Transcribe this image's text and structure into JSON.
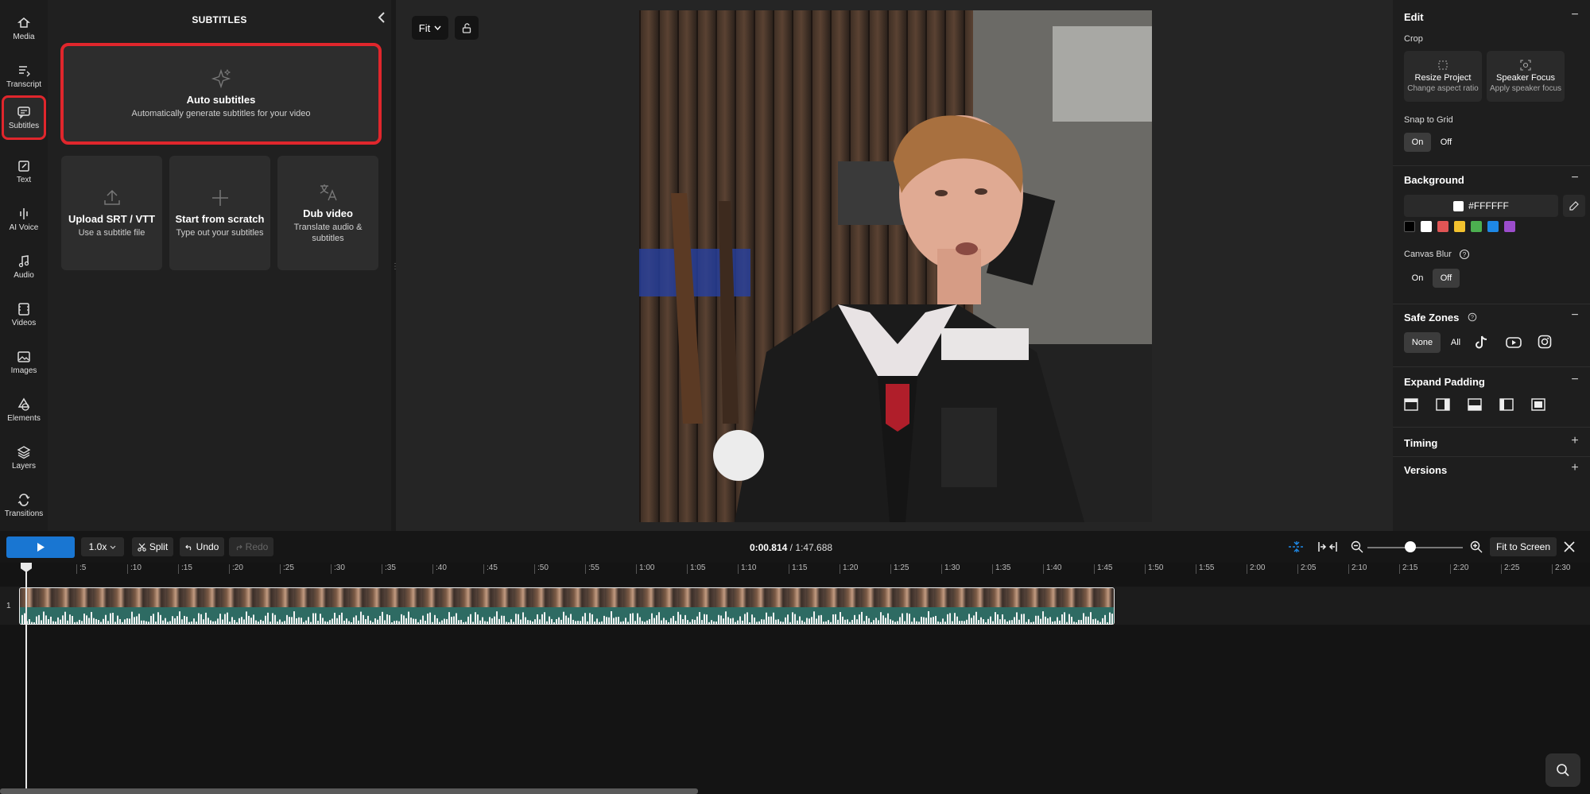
{
  "nav": {
    "items": [
      {
        "label": "Media",
        "icon": "media-icon"
      },
      {
        "label": "Transcript",
        "icon": "transcript-icon"
      },
      {
        "label": "Subtitles",
        "icon": "subtitles-icon"
      },
      {
        "label": "Text",
        "icon": "text-icon"
      },
      {
        "label": "AI Voice",
        "icon": "ai-voice-icon"
      },
      {
        "label": "Audio",
        "icon": "audio-icon"
      },
      {
        "label": "Videos",
        "icon": "videos-icon"
      },
      {
        "label": "Images",
        "icon": "images-icon"
      },
      {
        "label": "Elements",
        "icon": "elements-icon"
      },
      {
        "label": "Layers",
        "icon": "layers-icon"
      },
      {
        "label": "Transitions",
        "icon": "transitions-icon"
      }
    ],
    "active": "Subtitles"
  },
  "panel": {
    "title": "SUBTITLES",
    "auto": {
      "title": "Auto subtitles",
      "sub": "Automatically generate subtitles for your video"
    },
    "upload": {
      "title": "Upload SRT / VTT",
      "sub": "Use a subtitle file"
    },
    "scratch": {
      "title": "Start from scratch",
      "sub": "Type out your subtitles"
    },
    "dub": {
      "title": "Dub video",
      "sub": "Translate audio & subtitles"
    }
  },
  "canvas": {
    "fit_label": "Fit"
  },
  "right": {
    "edit": "Edit",
    "crop": "Crop",
    "resize": {
      "title": "Resize Project",
      "sub": "Change aspect ratio"
    },
    "speaker": {
      "title": "Speaker Focus",
      "sub": "Apply speaker focus"
    },
    "snap": "Snap to Grid",
    "on": "On",
    "off": "Off",
    "background": "Background",
    "bg_hex": "#FFFFFF",
    "swatches": [
      "#000000",
      "#ffffff",
      "#e05555",
      "#f2c12e",
      "#4caf50",
      "#1e88e5",
      "#9c4dcc"
    ],
    "canvas_blur": "Canvas Blur",
    "safe_zones": "Safe Zones",
    "none": "None",
    "all": "All",
    "expand_padding": "Expand Padding",
    "timing": "Timing",
    "versions": "Versions"
  },
  "timeline": {
    "speed": "1.0x",
    "split": "Split",
    "undo": "Undo",
    "redo": "Redo",
    "current_time": "0:00.814",
    "total_time": "1:47.688",
    "fit_to_screen": "Fit to Screen",
    "track_number": "1",
    "ticks": [
      ":5",
      ":10",
      ":15",
      ":20",
      ":25",
      ":30",
      ":35",
      ":40",
      ":45",
      ":50",
      ":55",
      "1:00",
      "1:05",
      "1:10",
      "1:15",
      "1:20",
      "1:25",
      "1:30",
      "1:35",
      "1:40",
      "1:45",
      "1:50",
      "1:55",
      "2:00",
      "2:05",
      "2:10",
      "2:15",
      "2:20",
      "2:25",
      "2:30"
    ],
    "tick_seconds": [
      5,
      10,
      15,
      20,
      25,
      30,
      35,
      40,
      45,
      50,
      55,
      60,
      65,
      70,
      75,
      80,
      85,
      90,
      95,
      100,
      105,
      110,
      115,
      120,
      125,
      130,
      135,
      140,
      145,
      150
    ]
  }
}
